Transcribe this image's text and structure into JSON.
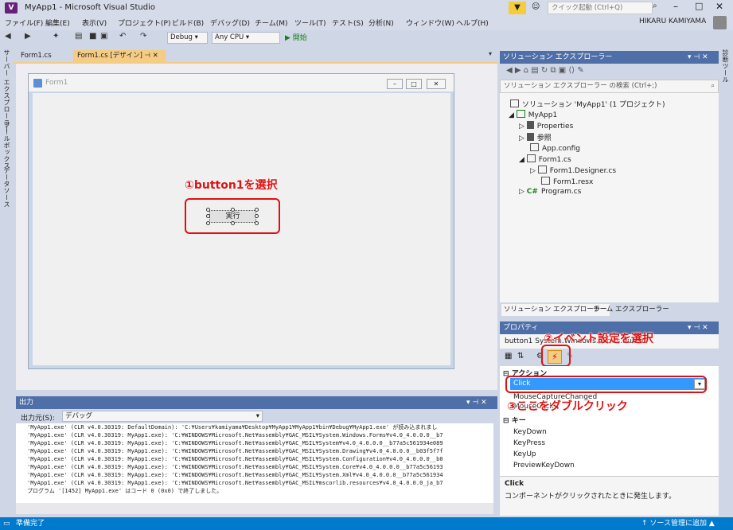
{
  "window": {
    "title": "MyApp1 - Microsoft Visual Studio",
    "quick_launch_placeholder": "クイック起動 (Ctrl+Q)",
    "user": "HIKARU KAMIYAMA"
  },
  "menu": [
    "ファイル(F)",
    "編集(E)",
    "表示(V)",
    "プロジェクト(P)",
    "ビルド(B)",
    "デバッグ(D)",
    "チーム(M)",
    "ツール(T)",
    "テスト(S)",
    "分析(N)",
    "ウィンドウ(W)",
    "ヘルプ(H)"
  ],
  "toolbar": {
    "config": "Debug",
    "platform": "Any CPU",
    "start": "▶ 開始"
  },
  "left_strip": [
    "サーバー エクスプローラー",
    "ツールボックス",
    "データソース"
  ],
  "right_strip": [
    "診断ツール"
  ],
  "doc_tabs": [
    {
      "label": "Form1.cs"
    },
    {
      "label": "Form1.cs [デザイン]",
      "active": true,
      "pin": "⊣",
      "close": "✕"
    }
  ],
  "designer": {
    "form_title": "Form1",
    "button_text": "実行"
  },
  "annotations": {
    "a1": "①button1を選択",
    "a2": "②イベント設定を選択",
    "a3": "③ここをダブルクリック"
  },
  "output": {
    "title": "出力",
    "source_label": "出力元(S):",
    "source_value": "デバッグ",
    "lines": [
      "'MyApp1.exe' (CLR v4.0.30319: DefaultDomain): 'C:¥Users¥kamiyama¥Desktop¥MyApp1¥MyApp1¥bin¥Debug¥MyApp1.exe' が読み込まれまし",
      "'MyApp1.exe' (CLR v4.0.30319: MyApp1.exe): 'C:¥WINDOWS¥Microsoft.Net¥assembly¥GAC_MSIL¥System.Windows.Forms¥v4.0_4.0.0.0__b7",
      "'MyApp1.exe' (CLR v4.0.30319: MyApp1.exe): 'C:¥WINDOWS¥Microsoft.Net¥assembly¥GAC_MSIL¥System¥v4.0_4.0.0.0__b77a5c561934e089",
      "'MyApp1.exe' (CLR v4.0.30319: MyApp1.exe): 'C:¥WINDOWS¥Microsoft.Net¥assembly¥GAC_MSIL¥System.Drawing¥v4.0_4.0.0.0__b03f5f7f",
      "'MyApp1.exe' (CLR v4.0.30319: MyApp1.exe): 'C:¥WINDOWS¥Microsoft.Net¥assembly¥GAC_MSIL¥System.Configuration¥v4.0_4.0.0.0__b0",
      "'MyApp1.exe' (CLR v4.0.30319: MyApp1.exe): 'C:¥WINDOWS¥Microsoft.Net¥assembly¥GAC_MSIL¥System.Core¥v4.0_4.0.0.0__b77a5c56193",
      "'MyApp1.exe' (CLR v4.0.30319: MyApp1.exe): 'C:¥WINDOWS¥Microsoft.Net¥assembly¥GAC_MSIL¥System.Xml¥v4.0_4.0.0.0__b77a5c561934",
      "'MyApp1.exe' (CLR v4.0.30319: MyApp1.exe): 'C:¥WINDOWS¥Microsoft.Net¥assembly¥GAC_MSIL¥mscorlib.resources¥v4.0_4.0.0.0_ja_b7",
      "プログラム '[1452] MyApp1.exe' はコード 0 (0x0) で終了しました。"
    ]
  },
  "solution_explorer": {
    "title": "ソリューション エクスプローラー",
    "search_placeholder": "ソリューション エクスプローラー の検索 (Ctrl+;)",
    "tree": [
      {
        "label": "ソリューション 'MyApp1' (1 プロジェクト)"
      },
      {
        "label": "MyApp1"
      },
      {
        "label": "Properties"
      },
      {
        "label": "参照"
      },
      {
        "label": "App.config"
      },
      {
        "label": "Form1.cs"
      },
      {
        "label": "Form1.Designer.cs"
      },
      {
        "label": "Form1.resx"
      },
      {
        "label": "Program.cs"
      }
    ],
    "tabs": [
      "ソリューション エクスプローラー",
      "チーム エクスプローラー"
    ]
  },
  "properties": {
    "title": "プロパティ",
    "object": "button1 System.Windows.Forms.Button",
    "cat_action": "アクション",
    "click": "Click",
    "mouse_capture": "MouseCaptureChanged",
    "mouse_click": "MouseClick",
    "cat_key": "キー",
    "key_events": [
      "KeyDown",
      "KeyPress",
      "KeyUp",
      "PreviewKeyDown"
    ],
    "desc_title": "Click",
    "desc_text": "コンポーネントがクリックされたときに発生します。"
  },
  "status": {
    "left": "準備完了",
    "right": "↑ ソース管理に追加 ▲"
  }
}
